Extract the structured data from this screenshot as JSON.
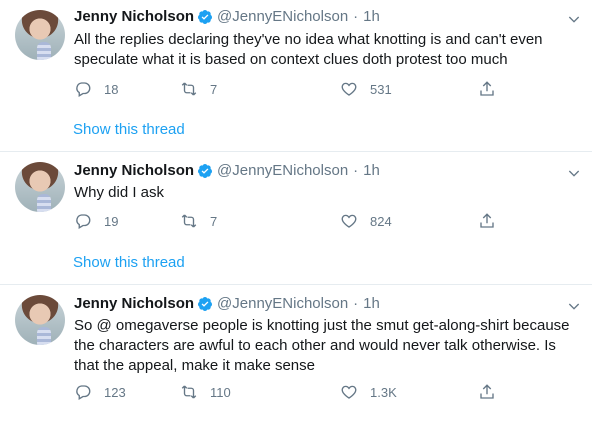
{
  "colors": {
    "accent": "#1da1f2",
    "muted": "#657786",
    "text": "#14171a",
    "border": "#e6ecf0"
  },
  "tweets": [
    {
      "name": "Jenny Nicholson",
      "handle": "@JennyENicholson",
      "separator": "·",
      "time": "1h",
      "text": "All the replies declaring they've no idea what knotting is and can't even speculate what it is based on context clues doth protest too much",
      "replies": "18",
      "retweets": "7",
      "likes": "531",
      "show_thread": "Show this thread"
    },
    {
      "name": "Jenny Nicholson",
      "handle": "@JennyENicholson",
      "separator": "·",
      "time": "1h",
      "text": "Why did I ask",
      "replies": "19",
      "retweets": "7",
      "likes": "824",
      "show_thread": "Show this thread"
    },
    {
      "name": "Jenny Nicholson",
      "handle": "@JennyENicholson",
      "separator": "·",
      "time": "1h",
      "text": "So @ omegaverse people is knotting just the smut get-along-shirt because the characters are awful to each other and would never talk otherwise. Is that the appeal, make it make sense",
      "replies": "123",
      "retweets": "110",
      "likes": "1.3K"
    }
  ],
  "icons": {
    "verified": "verified-badge-icon",
    "menu": "chevron-down-icon",
    "reply": "reply-icon",
    "retweet": "retweet-icon",
    "like": "heart-icon",
    "share": "share-icon"
  }
}
